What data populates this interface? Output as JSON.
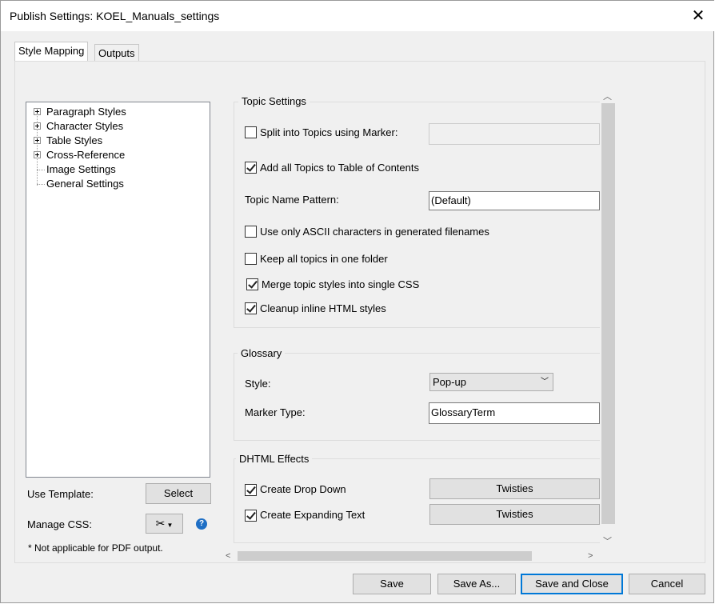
{
  "window": {
    "title": "Publish Settings: KOEL_Manuals_settings"
  },
  "tabs": [
    {
      "label": "Style Mapping",
      "active": true
    },
    {
      "label": "Outputs",
      "active": false
    }
  ],
  "tree": {
    "items": [
      {
        "label": "Paragraph Styles",
        "expandable": true
      },
      {
        "label": "Character Styles",
        "expandable": true
      },
      {
        "label": "Table Styles",
        "expandable": true
      },
      {
        "label": "Cross-Reference",
        "expandable": true
      },
      {
        "label": "Image Settings",
        "expandable": false
      },
      {
        "label": "General Settings",
        "expandable": false
      }
    ]
  },
  "left": {
    "use_template_label": "Use Template:",
    "select_button": "Select",
    "manage_css_label": "Manage CSS:",
    "note": "* Not applicable for PDF output."
  },
  "topic_settings": {
    "title": "Topic Settings",
    "split_label": "Split into Topics using Marker:",
    "split_checked": false,
    "split_value": "",
    "add_toc_label": "Add all Topics to Table of Contents",
    "add_toc_checked": true,
    "name_pattern_label": "Topic Name Pattern:",
    "name_pattern_value": "(Default)",
    "ascii_label": "Use only ASCII characters in generated filenames",
    "ascii_checked": false,
    "one_folder_label": "Keep all topics in one folder",
    "one_folder_checked": false,
    "merge_css_label": "Merge topic styles into single CSS",
    "merge_css_checked": true,
    "cleanup_label": "Cleanup inline HTML styles",
    "cleanup_checked": true
  },
  "glossary": {
    "title": "Glossary",
    "style_label": "Style:",
    "style_value": "Pop-up",
    "marker_type_label": "Marker Type:",
    "marker_type_value": "GlossaryTerm"
  },
  "dhtml": {
    "title": "DHTML Effects",
    "drop_down_label": "Create Drop Down",
    "drop_down_checked": true,
    "drop_down_button": "Twisties",
    "expanding_label": "Create Expanding Text",
    "expanding_checked": true,
    "expanding_button": "Twisties"
  },
  "footer": {
    "save": "Save",
    "save_as": "Save As...",
    "save_and_close": "Save and Close",
    "cancel": "Cancel"
  },
  "colors": {
    "accent": "#0078d7",
    "panel_bg": "#f0f0f0"
  }
}
